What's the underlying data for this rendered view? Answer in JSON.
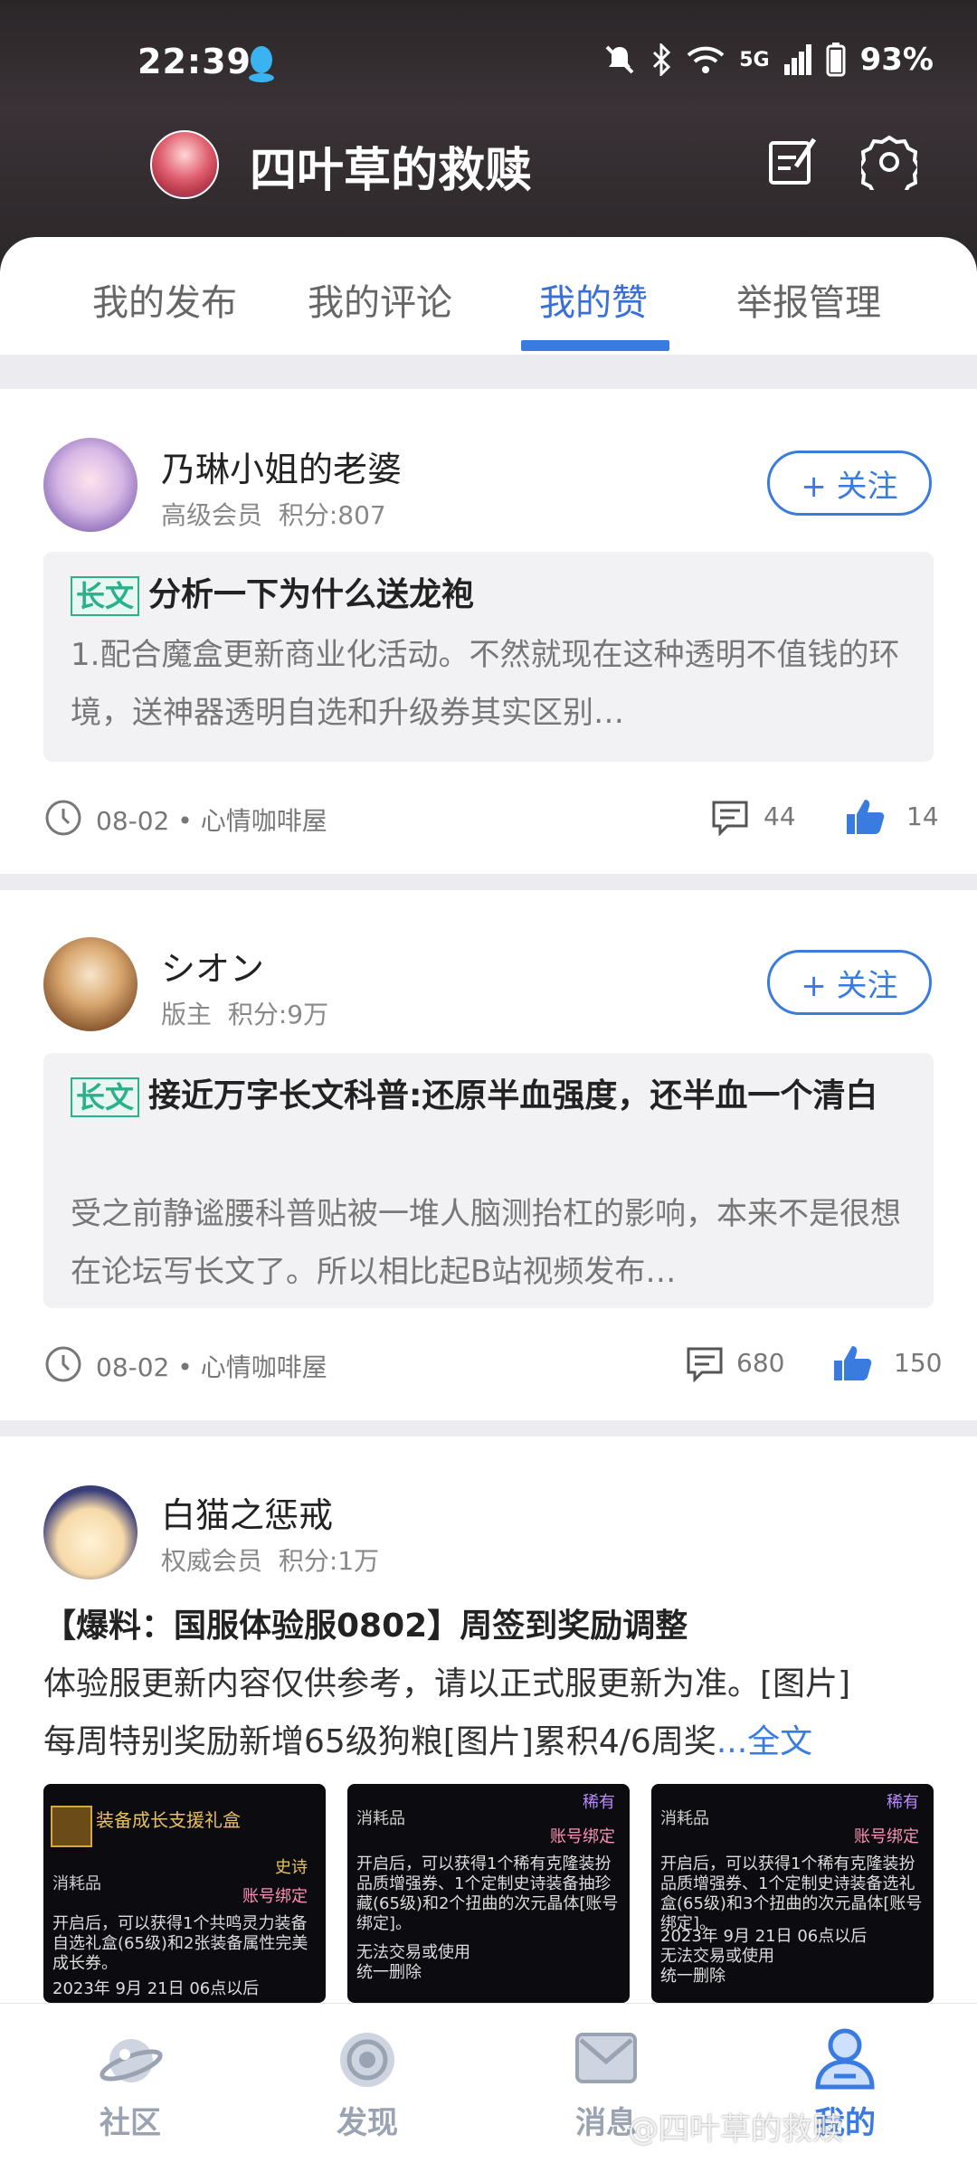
{
  "status": {
    "time": "22:39",
    "network": "5G",
    "battery": "93%"
  },
  "header": {
    "title": "四叶草的救赎",
    "edit_icon": "edit-icon",
    "settings_icon": "gear-icon"
  },
  "tabs": [
    {
      "label": "我的发布"
    },
    {
      "label": "我的评论"
    },
    {
      "label": "我的赞",
      "active": true
    },
    {
      "label": "举报管理"
    }
  ],
  "posts": [
    {
      "author": "乃琳小姐的老婆",
      "rank": "高级会员",
      "points": "积分:807",
      "follow": "+ 关注",
      "tag": "长文",
      "title": "分析一下为什么送龙袍",
      "excerpt": "1.配合魔盒更新商业化活动。不然就现在这种透明不值钱的环境，送神器透明自选和升级券其实区别…",
      "date": "08-02",
      "board": "心情咖啡屋",
      "comments": "44",
      "likes": "14"
    },
    {
      "author": "シオン",
      "rank": "版主",
      "points": "积分:9万",
      "follow": "+ 关注",
      "tag": "长文",
      "title": "接近万字长文科普:还原半血强度，还半血一个清白",
      "excerpt": "受之前静谧腰科普贴被一堆人脑测抬杠的影响，本来不是很想在论坛写长文了。所以相比起B站视频发布…",
      "date": "08-02",
      "board": "心情咖啡屋",
      "comments": "680",
      "likes": "150"
    },
    {
      "author": "白猫之惩戒",
      "rank": "权威会员",
      "points": "积分:1万",
      "title": "【爆料：国服体验服0802】周签到奖励调整",
      "excerpt_line1": "体验服更新内容仅供参考，请以正式服更新为准。[图片]",
      "excerpt_line2": "每周特别奖励新增65级狗粮[图片]累积4/6周奖",
      "more": "...全文",
      "thumbs": [
        {
          "title": "装备成长支援礼盒",
          "type": "消耗品",
          "grade": "史诗",
          "bind": "账号绑定",
          "desc": "开启后，可以获得1个共鸣灵力装备自选礼盒(65级)和2张装备属性完美成长券。",
          "date": "2023年 9月 21日 06点以后"
        },
        {
          "type": "消耗品",
          "grade": "稀有",
          "bind": "账号绑定",
          "desc": "开启后，可以获得1个稀有克隆装扮品质增强券、1个定制史诗装备抽珍藏(65级)和2个扭曲的次元晶体[账号绑定]。",
          "note": "无法交易或使用",
          "note2": "统一删除"
        },
        {
          "type": "消耗品",
          "grade": "稀有",
          "bind": "账号绑定",
          "desc": "开启后，可以获得1个稀有克隆装扮品质增强券、1个定制史诗装备选礼盒(65级)和3个扭曲的次元晶体[账号绑定]。",
          "date": "2023年 9月 21日 06点以后",
          "note": "无法交易或使用",
          "note2": "统一删除"
        }
      ]
    }
  ],
  "nav": [
    {
      "label": "社区",
      "icon": "planet-icon"
    },
    {
      "label": "发现",
      "icon": "discover-icon"
    },
    {
      "label": "消息",
      "icon": "mail-icon"
    },
    {
      "label": "我的",
      "icon": "user-icon",
      "active": true
    }
  ],
  "watermark": "@四叶草的救赎",
  "colors": {
    "accent": "#3a7be0",
    "tag": "#2ab08a"
  }
}
